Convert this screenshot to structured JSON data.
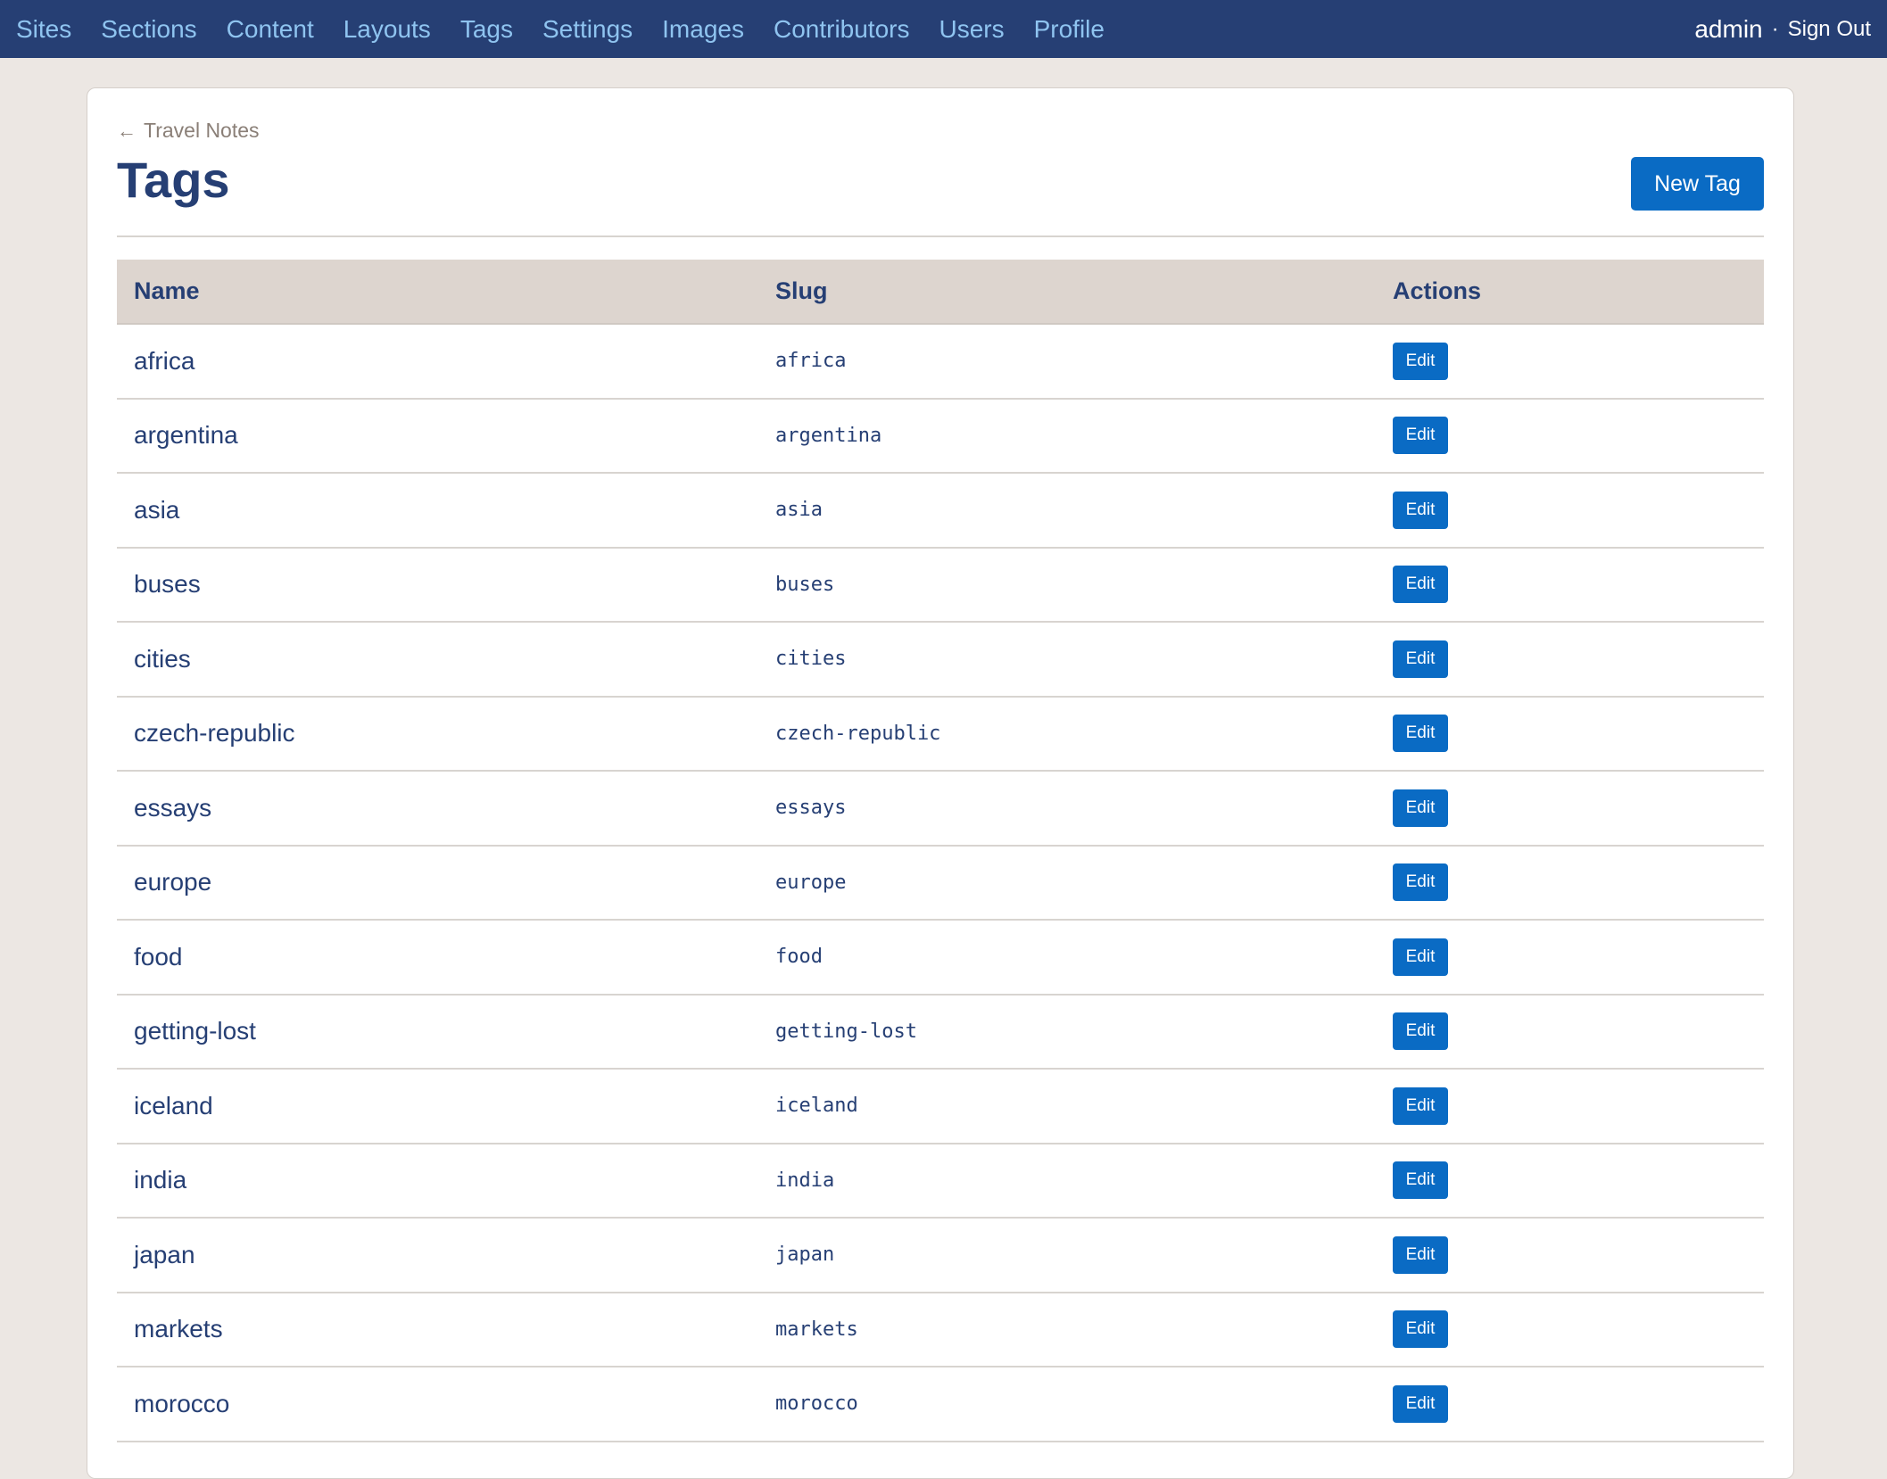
{
  "nav": {
    "links": [
      "Sites",
      "Sections",
      "Content",
      "Layouts",
      "Tags",
      "Settings",
      "Images",
      "Contributors",
      "Users",
      "Profile"
    ],
    "user": "admin",
    "separator": "·",
    "signout": "Sign Out"
  },
  "page": {
    "breadcrumb_arrow": "←",
    "breadcrumb": "Travel Notes",
    "title": "Tags",
    "new_button": "New Tag"
  },
  "table": {
    "headers": {
      "name": "Name",
      "slug": "Slug",
      "actions": "Actions"
    },
    "edit_label": "Edit",
    "rows": [
      {
        "name": "africa",
        "slug": "africa"
      },
      {
        "name": "argentina",
        "slug": "argentina"
      },
      {
        "name": "asia",
        "slug": "asia"
      },
      {
        "name": "buses",
        "slug": "buses"
      },
      {
        "name": "cities",
        "slug": "cities"
      },
      {
        "name": "czech-republic",
        "slug": "czech-republic"
      },
      {
        "name": "essays",
        "slug": "essays"
      },
      {
        "name": "europe",
        "slug": "europe"
      },
      {
        "name": "food",
        "slug": "food"
      },
      {
        "name": "getting-lost",
        "slug": "getting-lost"
      },
      {
        "name": "iceland",
        "slug": "iceland"
      },
      {
        "name": "india",
        "slug": "india"
      },
      {
        "name": "japan",
        "slug": "japan"
      },
      {
        "name": "markets",
        "slug": "markets"
      },
      {
        "name": "morocco",
        "slug": "morocco"
      }
    ]
  },
  "colors": {
    "nav_bg": "#263f74",
    "nav_link": "#8fc4f0",
    "accent": "#0a6bc4",
    "heading": "#263f74",
    "page_bg": "#ece7e3",
    "table_header_bg": "#ddd5cf"
  }
}
